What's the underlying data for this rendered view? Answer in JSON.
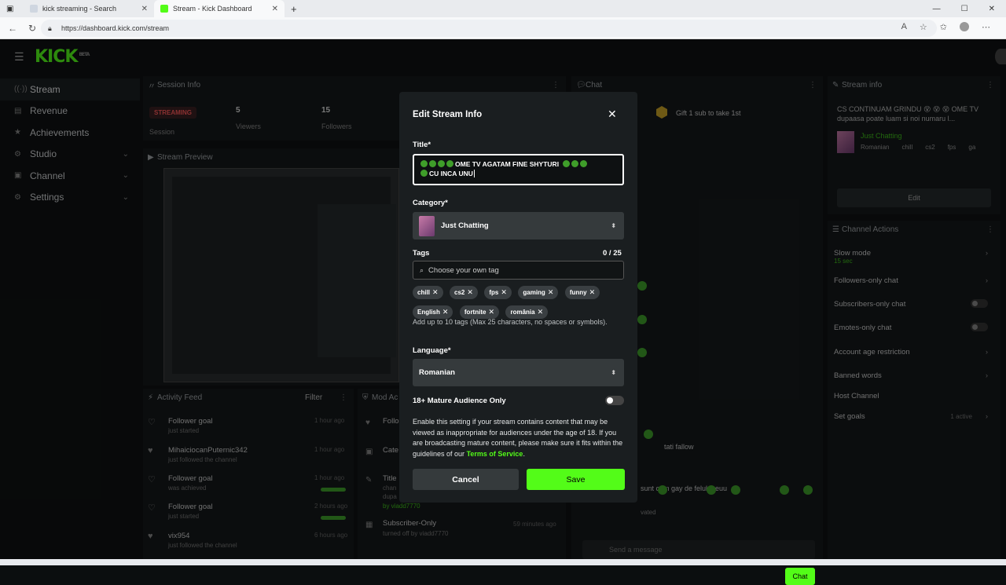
{
  "browser": {
    "tabs": [
      {
        "label": "kick streaming - Search"
      },
      {
        "label": "Stream - Kick Dashboard"
      }
    ],
    "url": "https://dashboard.kick.com/stream"
  },
  "app": {
    "logo": "KICK",
    "logo_badge": "BETA"
  },
  "sidebar": {
    "items": [
      {
        "label": "Stream"
      },
      {
        "label": "Revenue"
      },
      {
        "label": "Achievements"
      },
      {
        "label": "Studio"
      },
      {
        "label": "Channel"
      },
      {
        "label": "Settings"
      }
    ]
  },
  "session": {
    "title": "Session Info",
    "status": "STREAMING",
    "status_label": "Session",
    "viewers_value": "5",
    "viewers_label": "Viewers",
    "followers_value": "15",
    "followers_label": "Followers"
  },
  "preview": {
    "title": "Stream Preview"
  },
  "activity": {
    "title": "Activity Feed",
    "filter": "Filter",
    "items": [
      {
        "title": "Follower goal",
        "sub": "just started",
        "time": "1 hour ago"
      },
      {
        "title": "MihaiciocanPuternic342",
        "sub": "just followed the channel",
        "time": "1 hour ago"
      },
      {
        "title": "Follower goal",
        "sub": "was achieved",
        "time": "1 hour ago"
      },
      {
        "title": "Follower goal",
        "sub": "just started",
        "time": "2 hours ago"
      },
      {
        "title": "vix954",
        "sub": "just followed the channel",
        "time": "6 hours ago"
      }
    ]
  },
  "mod": {
    "title": "Mod Ac",
    "items": [
      {
        "title": "Follo"
      },
      {
        "title": "Cate"
      },
      {
        "title": "Title",
        "sub1": "chan",
        "sub2": "dupa",
        "sub3": "by viadd7770"
      },
      {
        "title": "Subscriber-Only",
        "sub": "turned off by viadd7770",
        "time": "59 minutes ago"
      }
    ]
  },
  "chat": {
    "title": "Chat",
    "gift": "Gift 1 sub to take 1st",
    "lines": [
      "tati fallow",
      "sunt cam gay de felul meuu",
      "vated"
    ],
    "input_placeholder": "Send a message",
    "send": "Chat"
  },
  "stream_info": {
    "title": "Stream info",
    "text": "CS CONTINUAM GRINDU 😵 😵 😵 OME TV dupaasa poate luam si noi numaru l...",
    "category": "Just Chatting",
    "tags": [
      "Romanian",
      "chill",
      "cs2",
      "fps",
      "ga"
    ],
    "edit": "Edit"
  },
  "channel_actions": {
    "title": "Channel Actions",
    "items": [
      {
        "label": "Slow mode",
        "sub": "15 sec"
      },
      {
        "label": "Followers-only chat"
      },
      {
        "label": "Subscribers-only chat"
      },
      {
        "label": "Emotes-only chat"
      },
      {
        "label": "Account age restriction"
      },
      {
        "label": "Banned words"
      },
      {
        "label": "Host Channel"
      },
      {
        "label": "Set goals",
        "sub": "1 active"
      }
    ]
  },
  "modal": {
    "title": "Edit Stream Info",
    "title_label": "Title*",
    "title_value": "OME TV AGATAM FINE SHYTURI",
    "title_value_2": "CU INCA UNU",
    "category_label": "Category*",
    "category_value": "Just Chatting",
    "tags_label": "Tags",
    "tags_count": "0 / 25",
    "tags_placeholder": "Choose your own tag",
    "tags": [
      "chill",
      "cs2",
      "fps",
      "gaming",
      "funny",
      "English",
      "fortnite",
      "românia"
    ],
    "tags_help": "Add up to 10 tags (Max 25 characters, no spaces or symbols).",
    "language_label": "Language*",
    "language_value": "Romanian",
    "mature_label": "18+ Mature Audience Only",
    "mature_enabled": false,
    "mature_help": "Enable this setting if your stream contains content that may be viewed as inappropriate for audiences under the age of 18. If you are broadcasting mature content, please make sure it fits within the guidelines of our",
    "mature_tos": "Terms of Service",
    "cancel": "Cancel",
    "save": "Save"
  },
  "colors": {
    "accent": "#53fc18",
    "live": "#ff5a5a",
    "bg": "#0f1213"
  }
}
